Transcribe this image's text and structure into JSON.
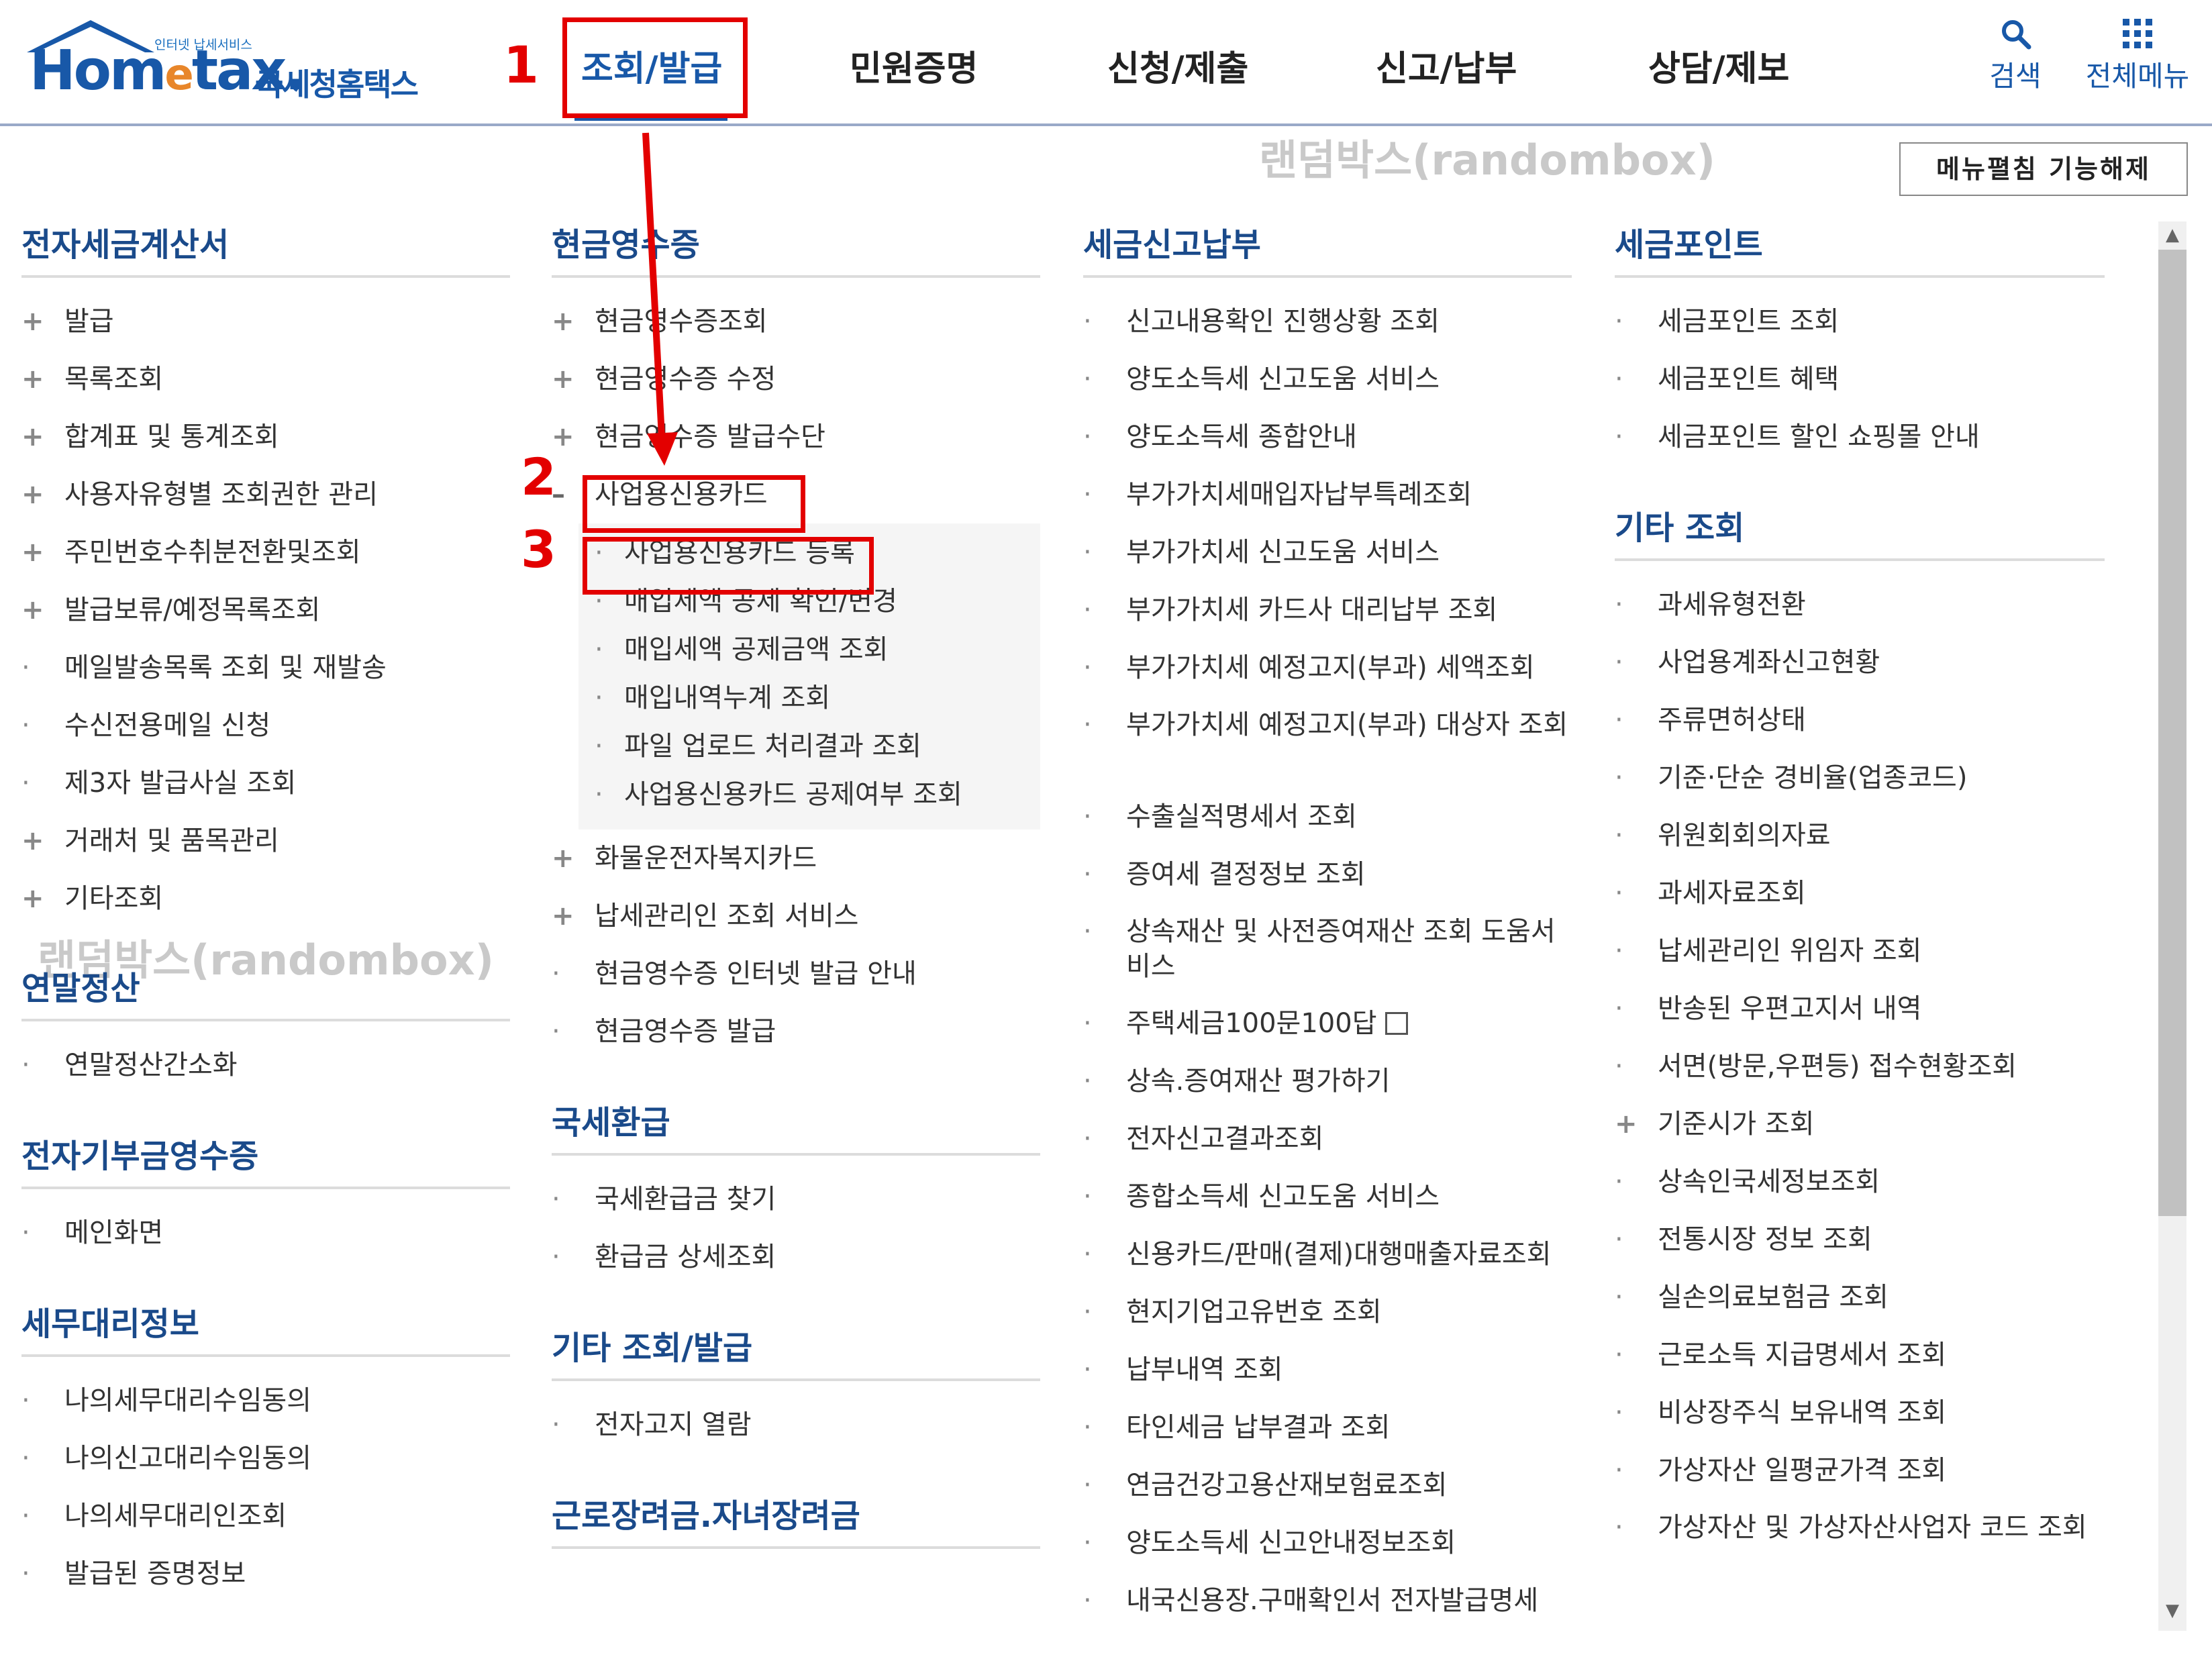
{
  "header": {
    "logo_tagline": "인터넷 납세서비스",
    "logo_brand_a": "Hom",
    "logo_brand_e": "e",
    "logo_brand_b": "tax.",
    "logo_korean": "국세청홈택스",
    "nav": [
      "조회/발급",
      "민원증명",
      "신청/제출",
      "신고/납부",
      "상담/제보"
    ],
    "search_label": "검색",
    "menu_label": "전체메뉴"
  },
  "annotations": {
    "step1": "1",
    "step2": "2",
    "step3": "3",
    "watermark": "랜덤박스(randombox)"
  },
  "toggle_button": "메뉴펼침 기능해제",
  "columns": {
    "col1": {
      "s1_title": "전자세금계산서",
      "s1_items": [
        "발급",
        "목록조회",
        "합계표 및 통계조회",
        "사용자유형별 조회권한 관리",
        "주민번호수취분전환및조회",
        "발급보류/예정목록조회",
        "메일발송목록 조회 및 재발송",
        "수신전용메일 신청",
        "제3자 발급사실 조회",
        "거래처 및 품목관리",
        "기타조회"
      ],
      "s2_title": "연말정산",
      "s2_items": [
        "연말정산간소화"
      ],
      "s3_title": "전자기부금영수증",
      "s3_items": [
        "메인화면"
      ],
      "s4_title": "세무대리정보",
      "s4_items": [
        "나의세무대리수임동의",
        "나의신고대리수임동의",
        "나의세무대리인조회",
        "발급된 증명정보"
      ]
    },
    "col2": {
      "s1_title": "현금영수증",
      "s1_items": [
        "현금영수증조회",
        "현금영수증 수정",
        "현금영수증 발급수단"
      ],
      "s1_open": "사업용신용카드",
      "s1_sub": [
        "사업용신용카드 등록",
        "매입세액 공제 확인/변경",
        "매입세액 공제금액 조회",
        "매입내역누계 조회",
        "파일 업로드 처리결과 조회",
        "사업용신용카드 공제여부 조회"
      ],
      "s1_items_b": [
        "화물운전자복지카드",
        "납세관리인 조회 서비스",
        "현금영수증 인터넷 발급 안내",
        "현금영수증 발급"
      ],
      "s2_title": "국세환급",
      "s2_items": [
        "국세환급금 찾기",
        "환급금 상세조회"
      ],
      "s3_title": "기타 조회/발급",
      "s3_items": [
        "전자고지 열람"
      ],
      "s4_title": "근로장려금.자녀장려금"
    },
    "col3": {
      "title": "세금신고납부",
      "items_a": [
        "신고내용확인 진행상황 조회",
        "양도소득세 신고도움 서비스",
        "양도소득세 종합안내",
        "부가가치세매입자납부특례조회",
        "부가가치세 신고도움 서비스",
        "부가가치세 카드사 대리납부 조회",
        "부가가치세 예정고지(부과) 세액조회"
      ],
      "tall_1": "부가가치세 예정고지(부과) 대상자 조회",
      "items_b": [
        "수출실적명세서 조회",
        "증여세 결정정보 조회"
      ],
      "tall_2": "상속재산 및 사전증여재산 조회 도움서비스",
      "ext_item": "주택세금100문100답",
      "items_c": [
        "상속.증여재산 평가하기",
        "전자신고결과조회",
        "종합소득세 신고도움 서비스",
        "신용카드/판매(결제)대행매출자료조회",
        "현지기업고유번호 조회",
        "납부내역 조회",
        "타인세금 납부결과 조회",
        "연금건강고용산재보험료조회",
        "양도소득세 신고안내정보조회",
        "내국신용장.구매확인서 전자발급명세"
      ]
    },
    "col4": {
      "s1_title": "세금포인트",
      "s1_items": [
        "세금포인트 조회",
        "세금포인트 혜택",
        "세금포인트 할인 쇼핑몰 안내"
      ],
      "s2_title": "기타 조회",
      "s2_items_a": [
        "과세유형전환",
        "사업용계좌신고현황",
        "주류면허상태",
        "기준·단순 경비율(업종코드)",
        "위원회회의자료",
        "과세자료조회",
        "납세관리인 위임자 조회",
        "반송된 우편고지서 내역",
        "서면(방문,우편등) 접수현황조회"
      ],
      "plus_item": "기준시가 조회",
      "s2_items_b": [
        "상속인국세정보조회",
        "전통시장 정보 조회",
        "실손의료보험금 조회",
        "근로소득 지급명세서 조회",
        "비상장주식 보유내역 조회",
        "가상자산 일평균가격 조회"
      ],
      "tall_1": "가상자산 및 가상자산사업자 코드 조회"
    }
  },
  "colors": {
    "accent": "#1858a8",
    "highlight": "#e30000",
    "heading": "#1a4a8a"
  }
}
